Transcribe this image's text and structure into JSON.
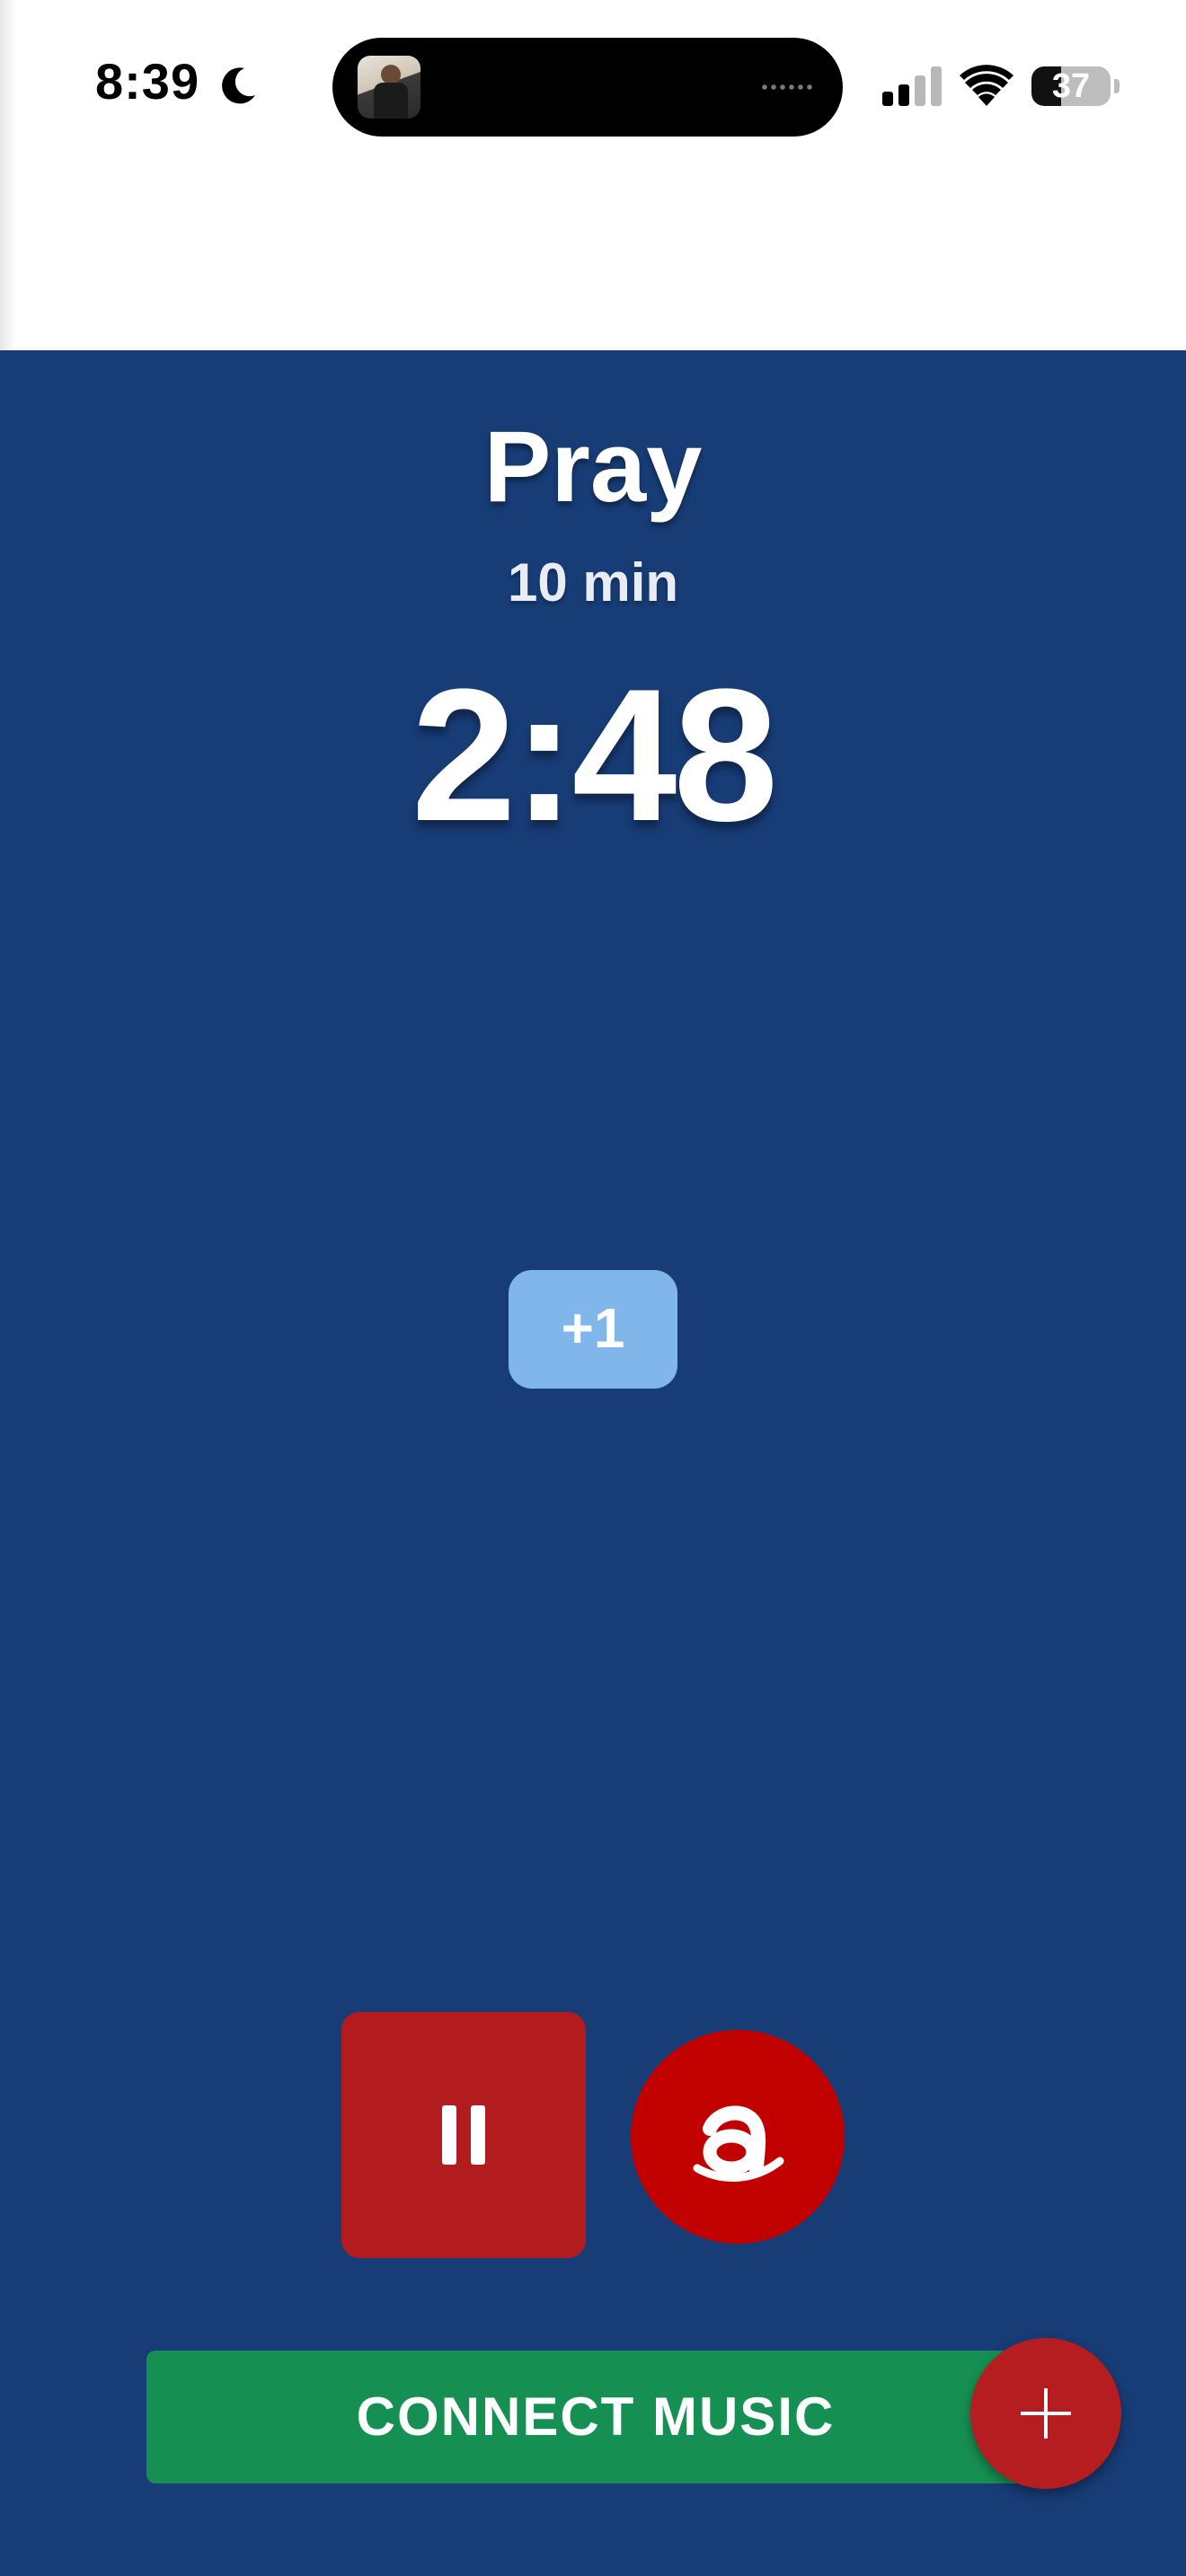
{
  "status_bar": {
    "time": "8:39",
    "battery_level": "37",
    "battery_fraction": 0.37,
    "icons": [
      "moon-icon",
      "signal-icon",
      "wifi-icon",
      "battery-icon"
    ]
  },
  "dynamic_island": {
    "icons": [
      "now-playing-thumbnail",
      "audio-waveform-dots"
    ]
  },
  "session": {
    "title": "Pray",
    "duration": "10 min",
    "timer": "2:48",
    "add_minute_label": "+1"
  },
  "controls": {
    "pause_icon": "pause-icon",
    "audible_icon": "audible-icon",
    "connect_music_label": "CONNECT MUSIC",
    "add_icon": "plus-icon"
  },
  "colors": {
    "panel_blue": "#173c76",
    "plus_one_blue": "#81b6ea",
    "pause_red": "#b31c1f",
    "audible_red": "#c10000",
    "connect_green": "#168f52",
    "fab_red": "#b51d20"
  }
}
